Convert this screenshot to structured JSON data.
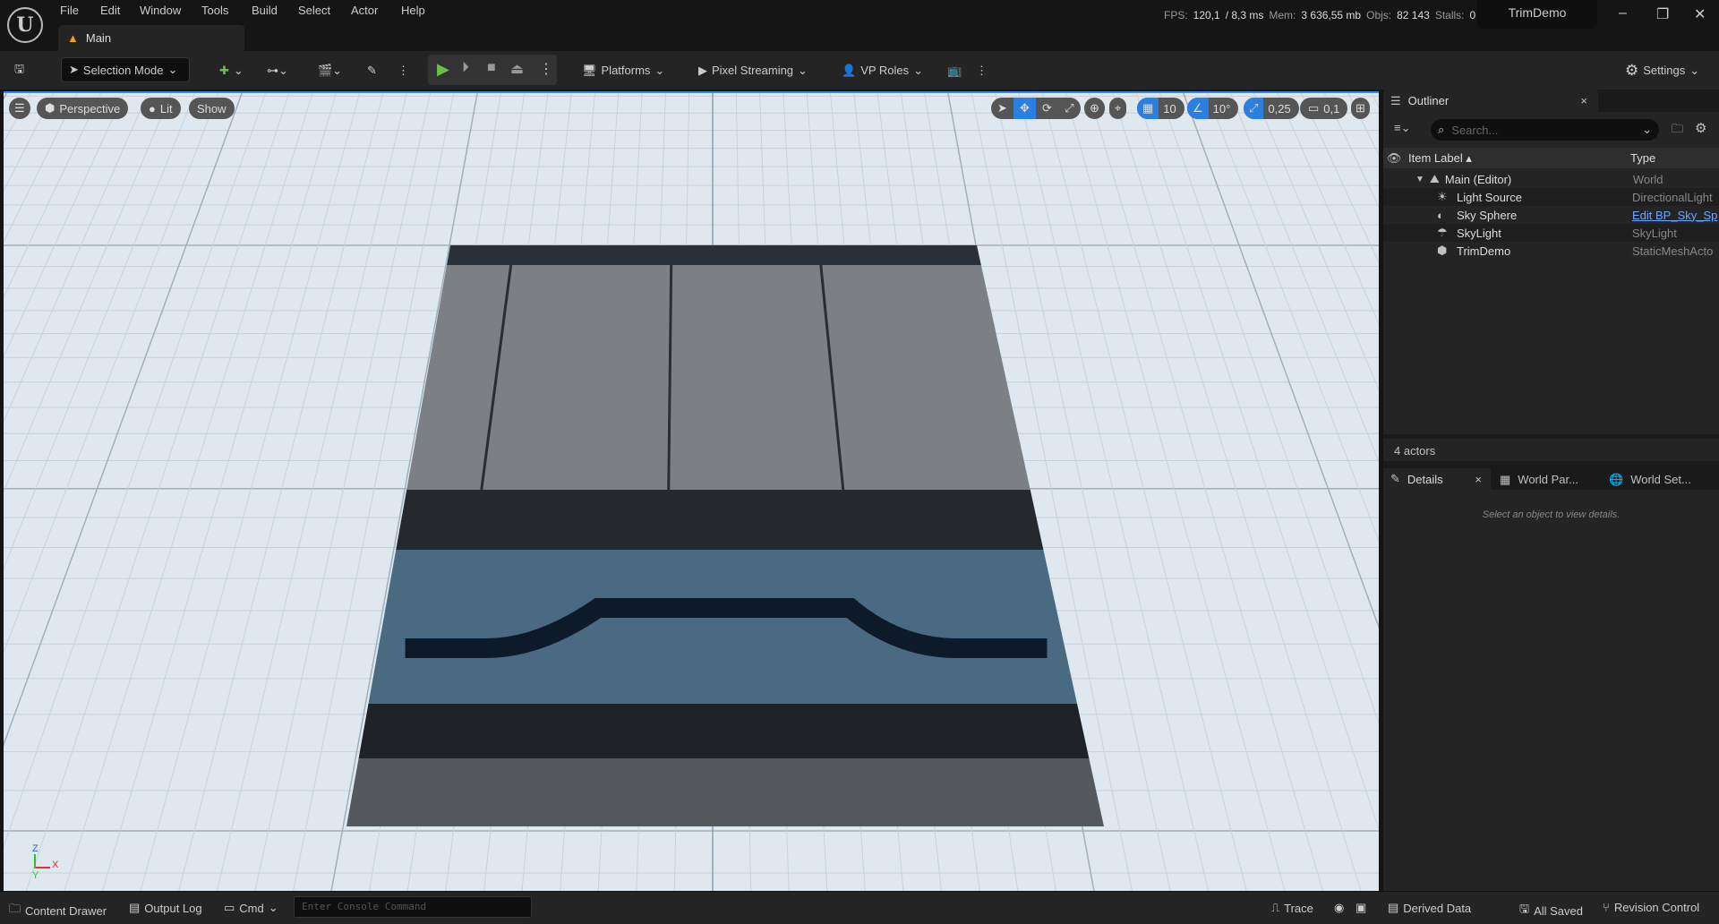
{
  "menu": [
    "File",
    "Edit",
    "Window",
    "Tools",
    "Build",
    "Select",
    "Actor",
    "Help"
  ],
  "tab": {
    "label": "Main"
  },
  "stats": {
    "fps_label": "FPS:",
    "fps": "120,1",
    "ms": "/ 8,3 ms",
    "mem_label": "Mem:",
    "mem": "3 636,55 mb",
    "objs_label": "Objs:",
    "objs": "82 143",
    "stalls_label": "Stalls:",
    "stalls": "0"
  },
  "project_name": "TrimDemo",
  "toolbar": {
    "selection_mode": "Selection Mode",
    "platforms": "Platforms",
    "pixel_streaming": "Pixel Streaming",
    "vp_roles": "VP Roles",
    "settings": "Settings"
  },
  "viewport": {
    "perspective": "Perspective",
    "lit": "Lit",
    "show": "Show",
    "grid_snap": "10",
    "rotation_snap": "10°",
    "scale_snap": "0,25",
    "camera_speed": "0,1",
    "axis_x": "X",
    "axis_y": "Y",
    "axis_z": "Z"
  },
  "outliner": {
    "title": "Outliner",
    "search_placeholder": "Search...",
    "col_label": "Item Label",
    "col_type": "Type",
    "root": {
      "label": "Main (Editor)",
      "type": "World"
    },
    "items": [
      {
        "label": "Light Source",
        "type": "DirectionalLight",
        "icon": "light-icon"
      },
      {
        "label": "Sky Sphere",
        "type": "Edit BP_Sky_Sp",
        "icon": "sphere-icon",
        "link": true
      },
      {
        "label": "SkyLight",
        "type": "SkyLight",
        "icon": "skylight-icon"
      },
      {
        "label": "TrimDemo",
        "type": "StaticMeshActo",
        "icon": "mesh-icon"
      }
    ],
    "count": "4 actors"
  },
  "details": {
    "tabs": [
      "Details",
      "World Par...",
      "World Set..."
    ],
    "empty": "Select an object to view details."
  },
  "statusbar": {
    "content_drawer": "Content Drawer",
    "output_log": "Output Log",
    "cmd": "Cmd",
    "console_placeholder": "Enter Console Command",
    "trace": "Trace",
    "derived_data": "Derived Data",
    "all_saved": "All Saved",
    "revision_control": "Revision Control"
  },
  "colors": {
    "accent": "#2a7fe0",
    "play": "#6cc04a",
    "viewport_bg": "#dfe8ef",
    "link": "#6ea8ff"
  }
}
